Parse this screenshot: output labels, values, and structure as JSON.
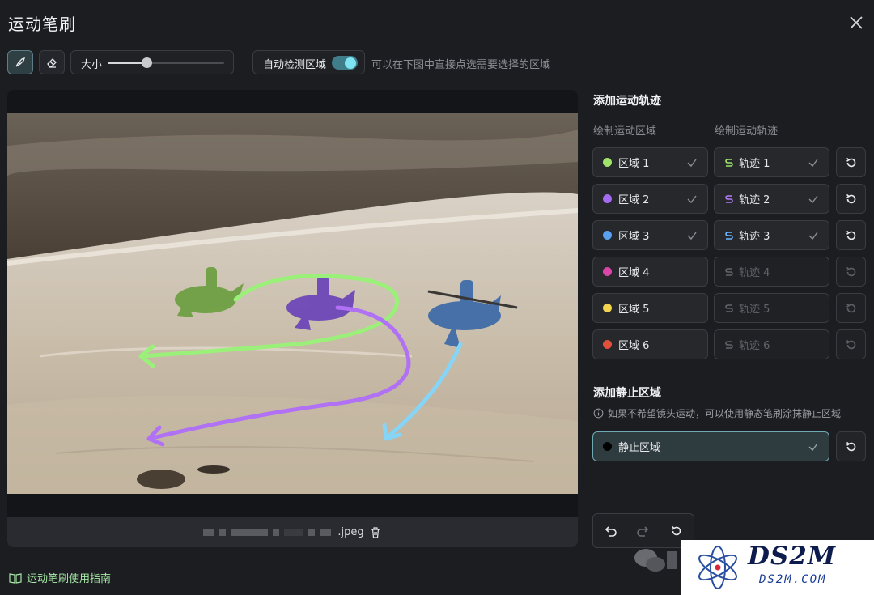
{
  "dialog": {
    "title": "运动笔刷"
  },
  "toolbar": {
    "brush_icon": "brush-icon",
    "eraser_icon": "eraser-icon",
    "size_label": "大小",
    "size_value": 0.33,
    "auto_detect_label": "自动检测区域",
    "auto_detect_on": true,
    "hint": "可以在下图中直接点选需要选择的区域"
  },
  "file": {
    "extension": ".jpeg",
    "delete_icon": "trash-icon"
  },
  "guide_link": "运动笔刷使用指南",
  "motion": {
    "title": "添加运动轨迹",
    "col_region": "绘制运动区域",
    "col_track": "绘制运动轨迹",
    "rows": [
      {
        "region": "区域 1",
        "color": "#9ee36a",
        "region_done": true,
        "track": "轨迹 1",
        "track_color": "#9ee36a",
        "track_done": true,
        "active": true
      },
      {
        "region": "区域 2",
        "color": "#a36bf0",
        "region_done": true,
        "track": "轨迹 2",
        "track_color": "#b07cf5",
        "track_done": true,
        "active": true
      },
      {
        "region": "区域 3",
        "color": "#5aa0f0",
        "region_done": true,
        "track": "轨迹 3",
        "track_color": "#6cb6ff",
        "track_done": true,
        "active": true
      },
      {
        "region": "区域 4",
        "color": "#d946a8",
        "region_done": false,
        "track": "轨迹 4",
        "track_color": "#62646a",
        "track_done": false,
        "active": false
      },
      {
        "region": "区域 5",
        "color": "#f3d44c",
        "region_done": false,
        "track": "轨迹 5",
        "track_color": "#62646a",
        "track_done": false,
        "active": false
      },
      {
        "region": "区域 6",
        "color": "#e0503a",
        "region_done": false,
        "track": "轨迹 6",
        "track_color": "#62646a",
        "track_done": false,
        "active": false
      }
    ]
  },
  "static": {
    "title": "添加静止区域",
    "desc": "如果不希望镜头运动，可以使用静态笔刷涂抹静止区域",
    "region": "静止区域",
    "color": "#000000"
  },
  "watermark": {
    "logo": "DS2M",
    "url": "DS2M.COM"
  }
}
